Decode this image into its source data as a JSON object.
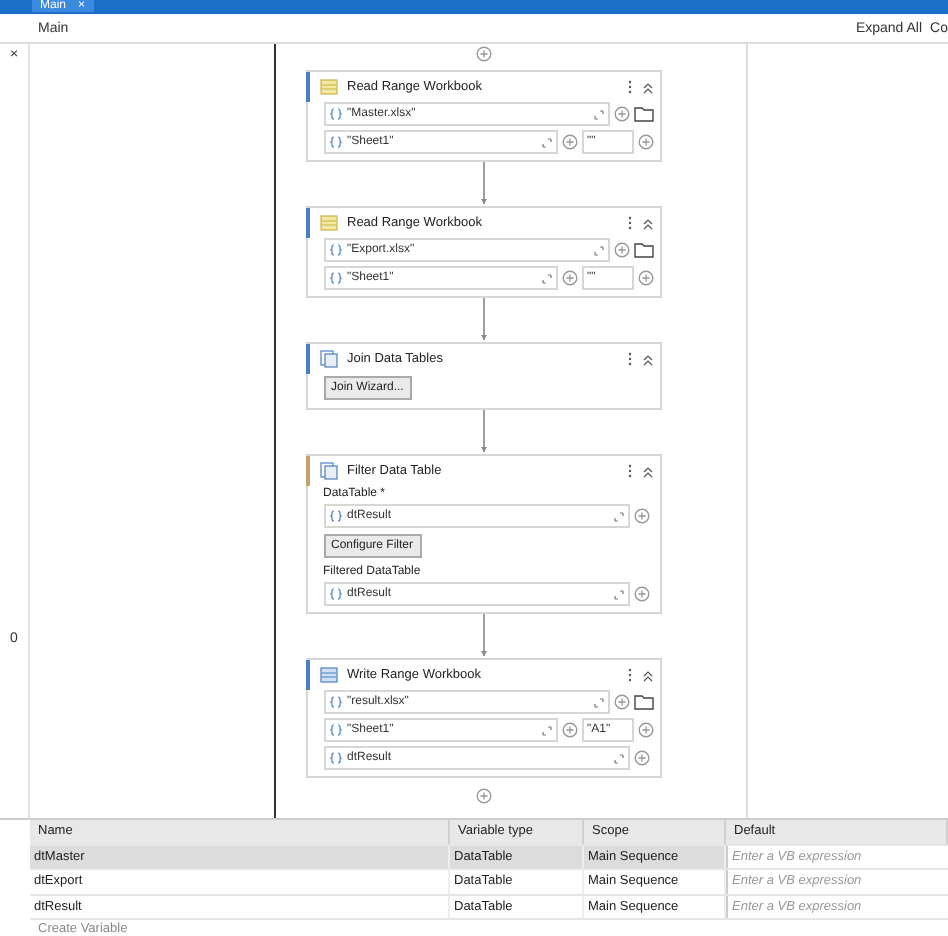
{
  "tabs": [
    {
      "label": "Main",
      "close": "×",
      "selected": true
    }
  ],
  "breadcrumb": {
    "path": "Main",
    "actions": [
      "Expand All",
      "Co"
    ]
  },
  "side_strip": [
    "×",
    "0"
  ],
  "activities": [
    {
      "kind": "read",
      "title": "Read Range Workbook",
      "color": "#4a7fc1",
      "items": [
        {
          "kind": "field",
          "value": "\"Master.xlsx\"",
          "browse": true
        },
        {
          "kind": "field",
          "value": "\"Sheet1\"",
          "range": "\"\""
        }
      ]
    },
    {
      "kind": "read",
      "title": "Read Range Workbook",
      "color": "#4a7fc1",
      "items": [
        {
          "kind": "field",
          "value": "\"Export.xlsx\"",
          "browse": true
        },
        {
          "kind": "field",
          "value": "\"Sheet1\"",
          "range": "\"\""
        }
      ]
    },
    {
      "kind": "table",
      "title": "Join Data Tables",
      "color": "#4a7fc1",
      "items": [
        {
          "kind": "button",
          "label": "Join Wizard..."
        }
      ]
    },
    {
      "kind": "table",
      "title": "Filter Data Table",
      "color": "#c8a070",
      "items": [
        {
          "kind": "label",
          "label": "DataTable *"
        },
        {
          "kind": "field",
          "value": "dtResult"
        },
        {
          "kind": "button",
          "label": "Configure Filter"
        },
        {
          "kind": "label",
          "label": "Filtered DataTable"
        },
        {
          "kind": "field",
          "value": "dtResult"
        }
      ]
    },
    {
      "kind": "write",
      "title": "Write Range Workbook",
      "color": "#4a7fc1",
      "items": [
        {
          "kind": "field",
          "value": "\"result.xlsx\"",
          "browse": true
        },
        {
          "kind": "field",
          "value": "\"Sheet1\"",
          "range": "\"A1\""
        },
        {
          "kind": "field",
          "value": "dtResult"
        }
      ]
    }
  ],
  "variables": {
    "columns": [
      "Name",
      "Variable type",
      "Scope",
      "Default"
    ],
    "rows": [
      {
        "name": "dtMaster",
        "type": "DataTable",
        "scope": "Main Sequence",
        "placeholder": "Enter a VB expression",
        "selected": true
      },
      {
        "name": "dtExport",
        "type": "DataTable",
        "scope": "Main Sequence",
        "placeholder": "Enter a VB expression",
        "selected": false
      },
      {
        "name": "dtResult",
        "type": "DataTable",
        "scope": "Main Sequence",
        "placeholder": "Enter a VB expression",
        "selected": false
      }
    ],
    "create": "Create Variable"
  }
}
